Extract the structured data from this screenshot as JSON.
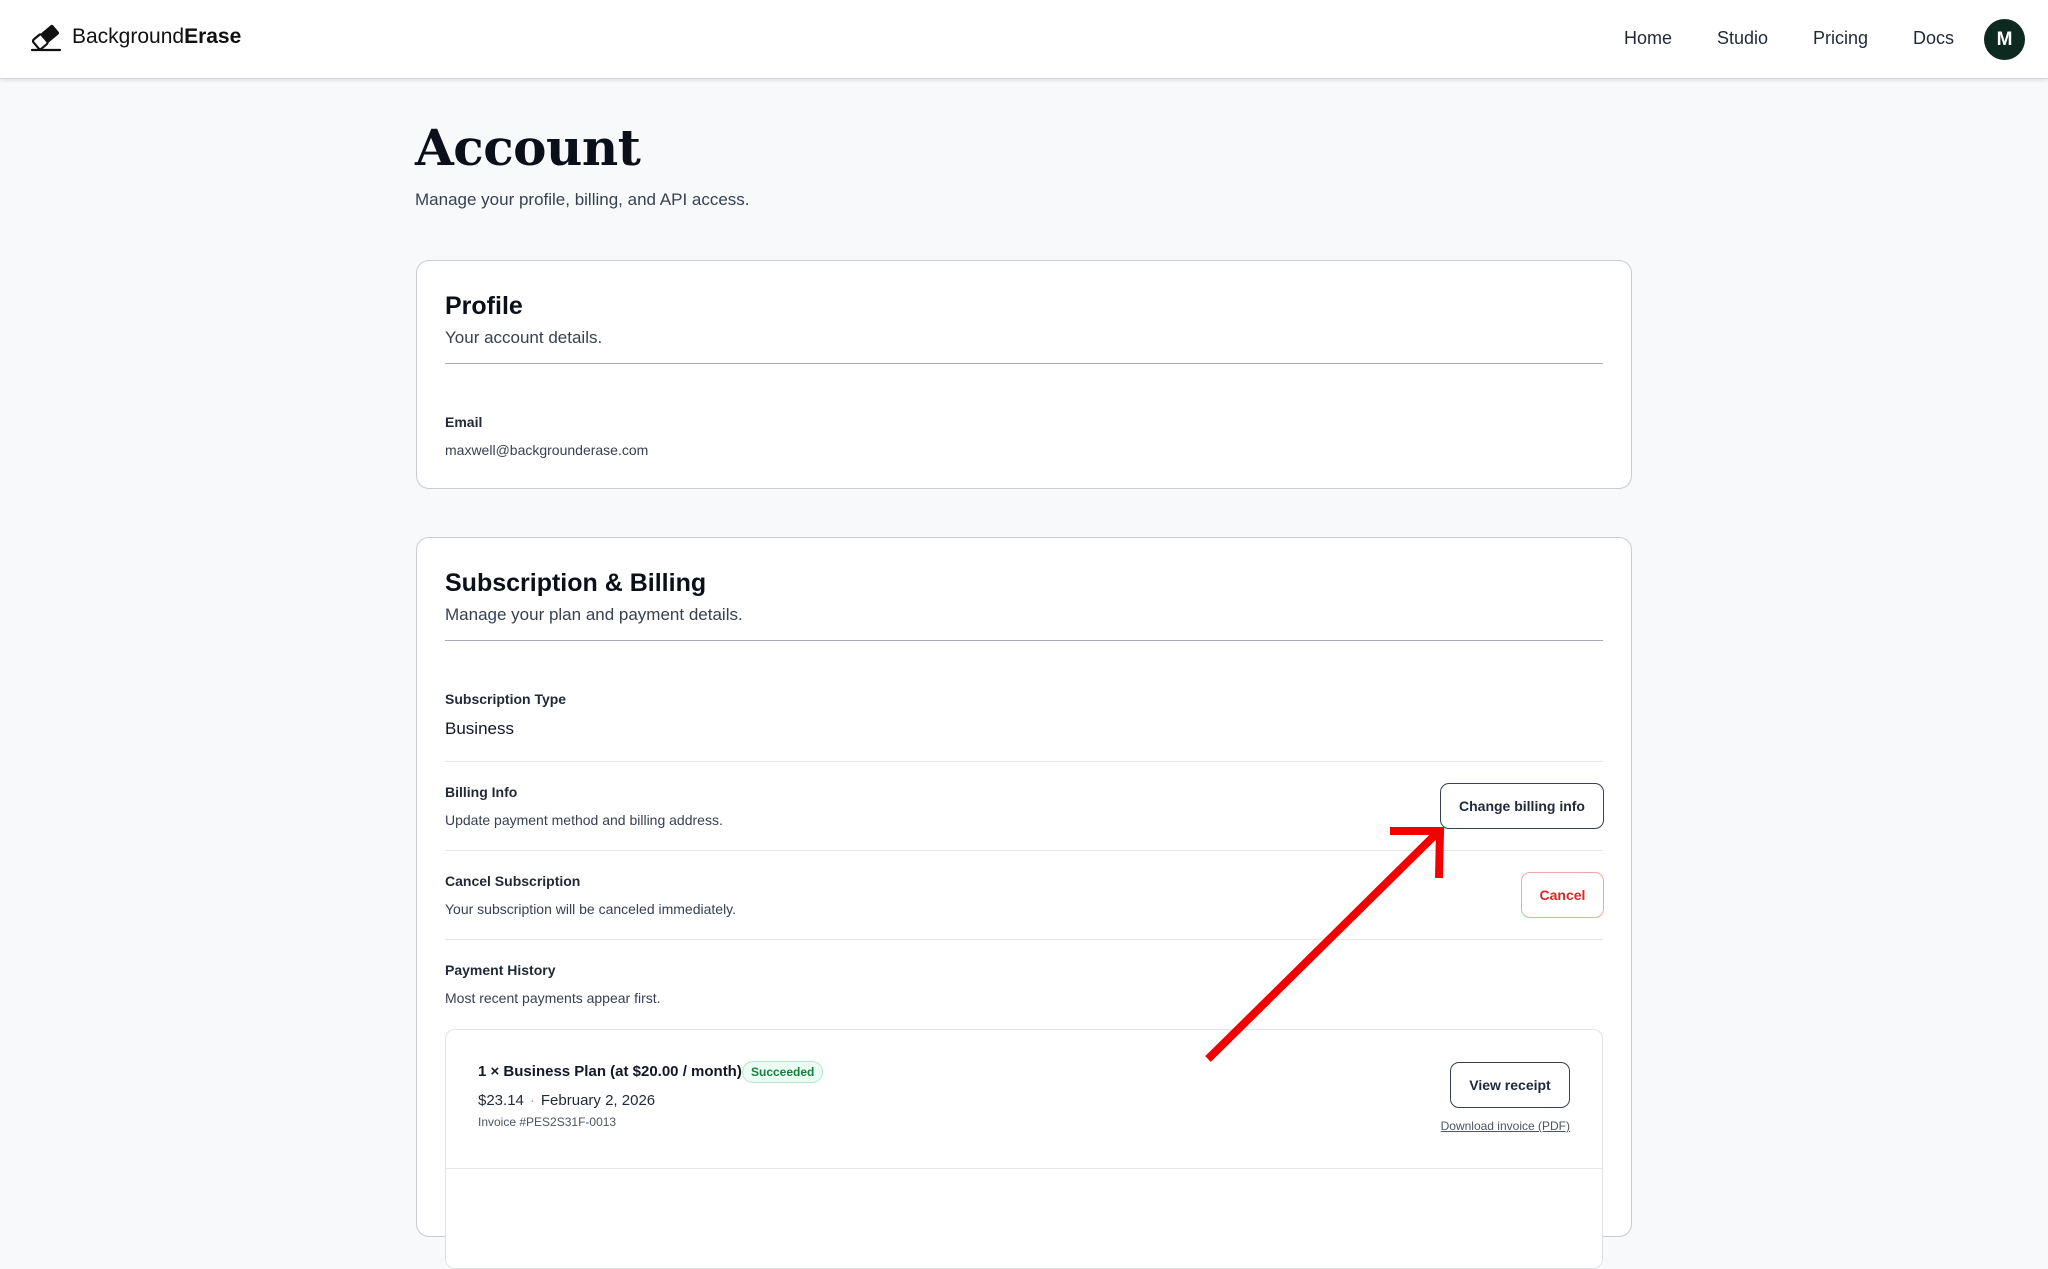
{
  "header": {
    "brand_regular": "Background",
    "brand_bold": "Erase",
    "logo_icon": "eraser-icon",
    "nav": [
      "Home",
      "Studio",
      "Pricing",
      "Docs"
    ],
    "avatar_initial": "M"
  },
  "page": {
    "title": "Account",
    "subtitle": "Manage your profile, billing, and API access."
  },
  "profile": {
    "title": "Profile",
    "description": "Your account details.",
    "email_label": "Email",
    "email_value": "maxwell@backgrounderase.com"
  },
  "billing": {
    "title": "Subscription & Billing",
    "description": "Manage your plan and payment details.",
    "subscription_type_label": "Subscription Type",
    "subscription_type_value": "Business",
    "billing_info_label": "Billing Info",
    "billing_info_desc": "Update payment method and billing address.",
    "change_billing_button": "Change billing info",
    "cancel_label": "Cancel Subscription",
    "cancel_desc": "Your subscription will be canceled immediately.",
    "cancel_button": "Cancel",
    "history_label": "Payment History",
    "history_desc": "Most recent payments appear first.",
    "payments": [
      {
        "title": "1 × Business Plan (at $20.00 / month)",
        "status": "Succeeded",
        "amount": "$23.14",
        "date": "February 2, 2026",
        "invoice": "Invoice #PES2S31F-0013",
        "view_receipt": "View receipt",
        "download_invoice": "Download invoice (PDF)"
      }
    ]
  },
  "colors": {
    "annotation_arrow": "#f20000",
    "success": "#15803d",
    "danger": "#dc2626",
    "avatar_bg": "#0d2a20"
  }
}
